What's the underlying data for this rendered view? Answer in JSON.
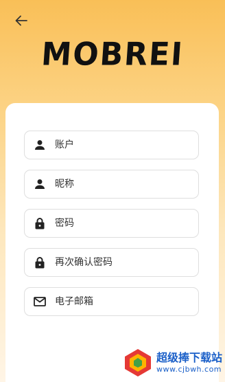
{
  "header": {
    "back_icon": "arrow-left-icon"
  },
  "logo": {
    "text": "MOBREI"
  },
  "form": {
    "account": {
      "placeholder": "账户",
      "icon": "person-icon"
    },
    "nickname": {
      "placeholder": "昵称",
      "icon": "person-icon"
    },
    "password": {
      "placeholder": "密码",
      "icon": "lock-icon"
    },
    "confirm_password": {
      "placeholder": "再次确认密码",
      "icon": "lock-icon"
    },
    "email": {
      "placeholder": "电子邮箱",
      "icon": "mail-icon"
    }
  },
  "watermark": {
    "title": "超级捧下载站",
    "url": "www.cjbwh.com"
  },
  "colors": {
    "gradient_top": "#f9bf57",
    "card": "#ffffff",
    "watermark": "#1a5fc8"
  }
}
